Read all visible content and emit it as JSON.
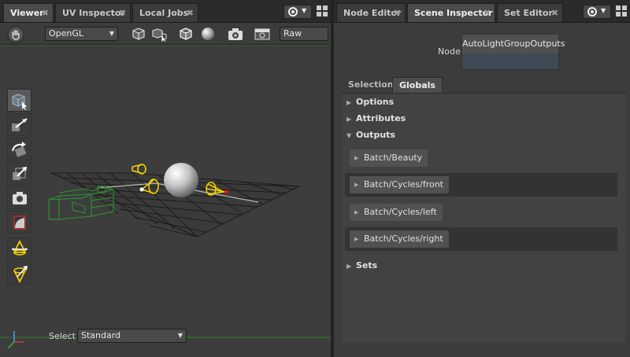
{
  "left_tabs": [
    {
      "label": "Viewer",
      "active": true
    },
    {
      "label": "UV Inspector",
      "active": false
    },
    {
      "label": "Local Jobs",
      "active": false
    }
  ],
  "right_tabs": [
    {
      "label": "Node Editor",
      "active": false
    },
    {
      "label": "Scene Inspector",
      "active": true
    },
    {
      "label": "Set Editor",
      "active": false
    }
  ],
  "close_glyph": "✖",
  "viewer": {
    "renderer": "OpenGL",
    "color_mode": "Raw",
    "select_label": "Select",
    "select_value": "Standard"
  },
  "inspector": {
    "node_label": "Node",
    "node_name": "AutoLightGroupOutputs",
    "subtabs": [
      "Selection",
      "Globals"
    ],
    "active_subtab": "Globals",
    "sections": [
      {
        "label": "Options",
        "expanded": false
      },
      {
        "label": "Attributes",
        "expanded": false
      },
      {
        "label": "Outputs",
        "expanded": true
      },
      {
        "label": "Sets",
        "expanded": false
      }
    ],
    "outputs": [
      "Batch/Beauty",
      "Batch/Cycles/front",
      "Batch/Cycles/left",
      "Batch/Cycles/right"
    ]
  },
  "colors": {
    "light_gizmo": "#f2d000",
    "selected_camera": "#2e8b2e",
    "active_tab": "#4a4a4a"
  },
  "icons": [
    "hand-icon",
    "cube-icon",
    "sphere-icon",
    "camera-icon",
    "move-icon",
    "rotate-icon",
    "scale-icon",
    "light-icon",
    "grid-icon",
    "axis-icon"
  ]
}
